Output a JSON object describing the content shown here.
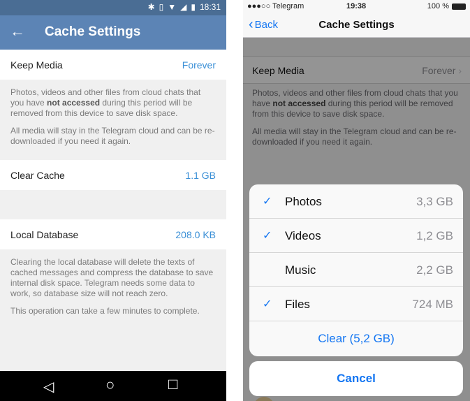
{
  "android": {
    "status": {
      "time": "18:31"
    },
    "appbar": {
      "back": "←",
      "title": "Cache Settings"
    },
    "keep_media": {
      "label": "Keep Media",
      "value": "Forever"
    },
    "keep_hint": {
      "p1_a": "Photos, videos and other files from cloud chats that you have ",
      "p1_bold": "not accessed",
      "p1_b": " during this period will be removed from this device to save disk space.",
      "p2": "All media will stay in the Telegram cloud and can be re-downloaded if you need it again."
    },
    "clear_cache": {
      "label": "Clear Cache",
      "value": "1.1 GB"
    },
    "local_db": {
      "label": "Local Database",
      "value": "208.0 KB"
    },
    "db_hint": {
      "p1": "Clearing the local database will delete the texts of cached messages and compress the database to save internal disk space. Telegram needs some data to work, so database size will not reach zero.",
      "p2": "This operation can take a few minutes to complete."
    },
    "nav": {
      "back": "◁",
      "home": "○",
      "recents": "□"
    }
  },
  "ios": {
    "status": {
      "carrier": "●●●○○ Telegram",
      "time": "19:38",
      "battery": "100 %"
    },
    "navbar": {
      "back": "Back",
      "title": "Cache Settings"
    },
    "keep_media": {
      "label": "Keep Media",
      "value": "Forever"
    },
    "keep_hint": {
      "p1_a": "Photos, videos and other files from cloud chats that you have ",
      "p1_bold": "not accessed",
      "p1_b": " during this period will be removed from this device to save disk space.",
      "p2": "All media will stay in the Telegram cloud and can be re-downloaded if you need it again."
    },
    "sheet": {
      "items": [
        {
          "name": "Photos",
          "size": "3,3 GB",
          "check": "✓"
        },
        {
          "name": "Videos",
          "size": "1,2 GB",
          "check": "✓"
        },
        {
          "name": "Music",
          "size": "2,2 GB",
          "check": ""
        },
        {
          "name": "Files",
          "size": "724 MB",
          "check": "✓"
        }
      ],
      "clear": "Clear (5,2 GB)",
      "cancel": "Cancel"
    }
  },
  "colors": {
    "android_appbar": "#5c84b5",
    "android_accent": "#3a8fd6",
    "ios_accent": "#1476f2"
  }
}
